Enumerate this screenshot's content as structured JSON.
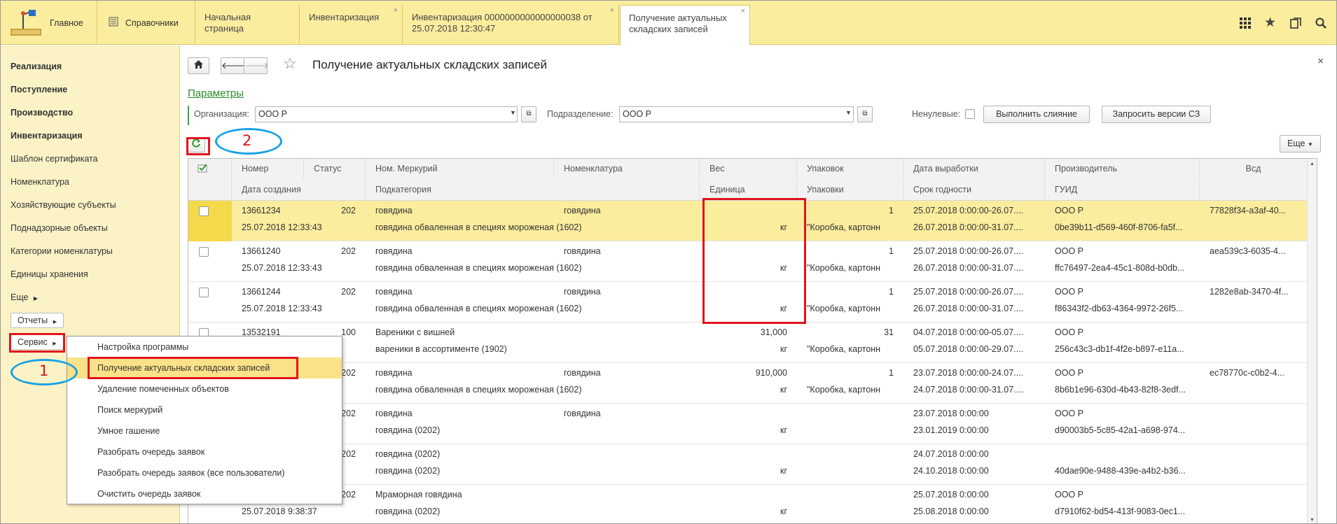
{
  "topbar": {
    "sections": [
      {
        "icon": "home-app-icon",
        "label": "Главное"
      },
      {
        "icon": "reference-book-icon",
        "label": "Справочники"
      }
    ],
    "tabs": [
      {
        "label": "Начальная страница",
        "closable": false,
        "active": false
      },
      {
        "label": "Инвентаризация",
        "closable": true,
        "active": false
      },
      {
        "label": "Инвентаризация 0000000000000000038 от 25.07.2018 12:30:47",
        "closable": true,
        "active": false
      },
      {
        "label": "Получение актуальных складских записей",
        "closable": true,
        "active": true
      }
    ],
    "right_icons": [
      "apps-grid-icon",
      "star-icon",
      "history-icon",
      "search-icon"
    ],
    "close_glyph": "×"
  },
  "sidebar": {
    "items": [
      {
        "label": "Реализация",
        "bold": true
      },
      {
        "label": "Поступление",
        "bold": true
      },
      {
        "label": "Производство",
        "bold": true
      },
      {
        "label": "Инвентаризация",
        "bold": true
      },
      {
        "label": "Шаблон сертификата",
        "bold": false
      },
      {
        "label": "Номенклатура",
        "bold": false
      },
      {
        "label": "Хозяйствующие субъекты",
        "bold": false
      },
      {
        "label": "Поднадзорные объекты",
        "bold": false
      },
      {
        "label": "Категории номенклатуры",
        "bold": false
      },
      {
        "label": "Единицы хранения",
        "bold": false
      }
    ],
    "more": "Еще",
    "reports_button": "Отчеты",
    "service_button": "Сервис"
  },
  "service_menu": {
    "items": [
      {
        "label": "Настройка программы",
        "selected": false
      },
      {
        "label": "Получение актуальных складских записей",
        "selected": true
      },
      {
        "label": "Удаление помеченных объектов",
        "selected": false
      },
      {
        "label": "Поиск меркурий",
        "selected": false
      },
      {
        "label": "Умное гашение",
        "selected": false
      },
      {
        "label": "Разобрать очередь заявок",
        "selected": false
      },
      {
        "label": "Разобрать очередь заявок (все пользователи)",
        "selected": false
      },
      {
        "label": "Очистить очередь заявок",
        "selected": false
      }
    ]
  },
  "form": {
    "title": "Получение актуальных складских записей",
    "close_glyph": "×",
    "params_link": "Параметры",
    "org_label": "Организация:",
    "org_value": "ООО Р",
    "division_label": "Подразделение:",
    "division_value": "ООО Р",
    "nonzero_label": "Ненулевые:",
    "merge_button": "Выполнить слияние",
    "request_button": "Запросить версии СЗ",
    "more_button": "Еще"
  },
  "annotations": {
    "marker_1": "1",
    "marker_2": "2"
  },
  "table": {
    "header_top": [
      "Номер",
      "Статус",
      "Ном. Меркурий",
      "Номенклатура",
      "Вес",
      "Упаковок",
      "Дата выработки",
      "Производитель",
      "Всд"
    ],
    "header_bottom": [
      "Дата создания",
      "Подкатегория",
      "Единица",
      "Упаковки",
      "Срок годности",
      "ГУИД"
    ],
    "rows": [
      {
        "selected": true,
        "number": "13661234",
        "status": "202",
        "nom_mercury": "говядина",
        "nomenclature": "говядина",
        "weight": "",
        "packs": "1",
        "date_prod": "25.07.2018 0:00:00-26.07....",
        "producer": "ООО Р",
        "vsd": "77828f34-a3af-40...",
        "date_created": "25.07.2018 12:33:43",
        "subcategory": "говядина обваленная в специях мороженая (1602)",
        "unit": "кг",
        "packaging": "\"Коробка, картонн",
        "expiry": "26.07.2018 0:00:00-31.07....",
        "guid": "0be39b11-d569-460f-8706-fa5f..."
      },
      {
        "selected": false,
        "number": "13661240",
        "status": "202",
        "nom_mercury": "говядина",
        "nomenclature": "говядина",
        "weight": "",
        "packs": "1",
        "date_prod": "25.07.2018 0:00:00-26.07....",
        "producer": "ООО Р",
        "vsd": "aea539c3-6035-4...",
        "date_created": "25.07.2018 12:33:43",
        "subcategory": "говядина обваленная в специях мороженая (1602)",
        "unit": "кг",
        "packaging": "\"Коробка, картонн",
        "expiry": "26.07.2018 0:00:00-31.07....",
        "guid": "ffc76497-2ea4-45c1-808d-b0db..."
      },
      {
        "selected": false,
        "number": "13661244",
        "status": "202",
        "nom_mercury": "говядина",
        "nomenclature": "говядина",
        "weight": "",
        "packs": "1",
        "date_prod": "25.07.2018 0:00:00-26.07....",
        "producer": "ООО Р",
        "vsd": "1282e8ab-3470-4f...",
        "date_created": "25.07.2018 12:33:43",
        "subcategory": "говядина обваленная в специях мороженая (1602)",
        "unit": "кг",
        "packaging": "\"Коробка, картонн",
        "expiry": "26.07.2018 0:00:00-31.07....",
        "guid": "f86343f2-db63-4364-9972-26f5..."
      },
      {
        "selected": false,
        "number": "13532191",
        "status": "100",
        "nom_mercury": "Вареники с вишней",
        "nomenclature": "",
        "weight": "31,000",
        "packs": "31",
        "date_prod": "04.07.2018 0:00:00-05.07....",
        "producer": "ООО Р",
        "vsd": "",
        "date_created": "",
        "subcategory": "вареники в ассортименте (1902)",
        "unit": "кг",
        "packaging": "\"Коробка, картонн",
        "expiry": "05.07.2018 0:00:00-29.07....",
        "guid": "256c43c3-db1f-4f2e-b897-e11a..."
      },
      {
        "selected": false,
        "number": "",
        "status": "202",
        "nom_mercury": "говядина",
        "nomenclature": "говядина",
        "weight": "910,000",
        "packs": "1",
        "date_prod": "23.07.2018 0:00:00-24.07....",
        "producer": "ООО Р",
        "vsd": "ec78770c-c0b2-4...",
        "date_created": "",
        "subcategory": "говядина обваленная в специях мороженая (1602)",
        "unit": "кг",
        "packaging": "\"Коробка, картонн",
        "expiry": "24.07.2018 0:00:00-31.07....",
        "guid": "8b6b1e96-630d-4b43-82f8-3edf..."
      },
      {
        "selected": false,
        "number": "",
        "status": "202",
        "nom_mercury": "говядина",
        "nomenclature": "говядина",
        "weight": "",
        "packs": "",
        "date_prod": "23.07.2018 0:00:00",
        "producer": "ООО Р",
        "vsd": "",
        "date_created": "",
        "subcategory": "говядина (0202)",
        "unit": "кг",
        "packaging": "",
        "expiry": "23.01.2019 0:00:00",
        "guid": "d90003b5-5c85-42a1-a698-974..."
      },
      {
        "selected": false,
        "number": "",
        "status": "202",
        "nom_mercury": "говядина (0202)",
        "nomenclature": "",
        "weight": "",
        "packs": "",
        "date_prod": "24.07.2018 0:00:00",
        "producer": "",
        "vsd": "",
        "date_created": "",
        "subcategory": "говядина (0202)",
        "unit": "кг",
        "packaging": "",
        "expiry": "24.10.2018 0:00:00",
        "guid": "40dae90e-9488-439e-a4b2-b36..."
      },
      {
        "selected": false,
        "number": "",
        "status": "202",
        "nom_mercury": "Мраморная говядина",
        "nomenclature": "",
        "weight": "",
        "packs": "",
        "date_prod": "25.07.2018 0:00:00",
        "producer": "ООО Р",
        "vsd": "",
        "date_created": "25.07.2018 9:38:37",
        "subcategory": "говядина (0202)",
        "unit": "кг",
        "packaging": "",
        "expiry": "25.08.2018 0:00:00",
        "guid": "d7910f62-bd54-413f-9083-0ec1..."
      }
    ]
  }
}
